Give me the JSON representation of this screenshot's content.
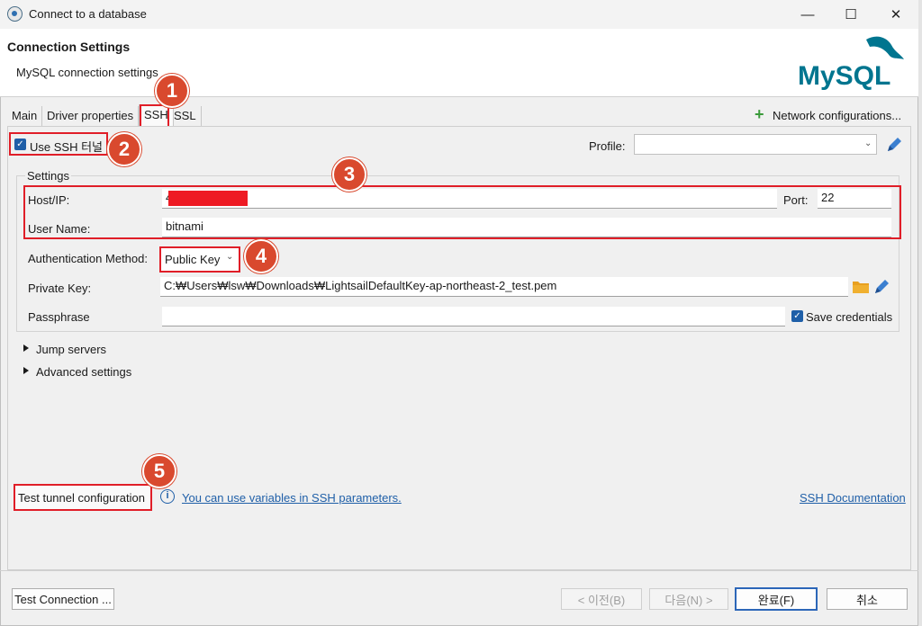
{
  "window": {
    "title": "Connect to a database",
    "minimize": "—",
    "maximize": "☐",
    "close": "✕"
  },
  "header": {
    "title": "Connection Settings",
    "subtitle": "MySQL connection settings",
    "logo_text": "MySQL"
  },
  "tabs": [
    {
      "label": "Main"
    },
    {
      "label": "Driver properties"
    },
    {
      "label": "SSH"
    },
    {
      "label": "SSL"
    }
  ],
  "network_config": "Network configurations...",
  "ssh": {
    "use_tunnel_label": "Use SSH 터널",
    "use_tunnel_checked": true,
    "profile_label": "Profile:",
    "profile_value": "",
    "settings_group": "Settings",
    "host_label": "Host/IP:",
    "host_value": "4",
    "port_label": "Port:",
    "port_value": "22",
    "username_label": "User Name:",
    "username_value": "bitnami",
    "auth_label": "Authentication Method:",
    "auth_value": "Public Key",
    "private_key_label": "Private Key:",
    "private_key_value": "C:₩Users₩lsw₩Downloads₩LightsailDefaultKey-ap-northeast-2_test.pem",
    "passphrase_label": "Passphrase",
    "passphrase_value": "",
    "save_credentials_label": "Save credentials",
    "save_credentials_checked": true,
    "jump_servers": "Jump servers",
    "advanced_settings": "Advanced settings",
    "test_tunnel": "Test tunnel configuration",
    "variables_hint": "You can use variables in SSH parameters.",
    "ssh_docs": "SSH Documentation"
  },
  "annotations": [
    "1",
    "2",
    "3",
    "4",
    "5"
  ],
  "footer": {
    "test_connection": "Test Connection ...",
    "back": "< 이전(B)",
    "next": "다음(N) >",
    "finish": "완료(F)",
    "cancel": "취소"
  },
  "colors": {
    "annotation_red": "#e01e28",
    "badge": "#d9492e",
    "link": "#1f5fa8",
    "accent": "#2c66b8",
    "mysql_blue": "#00758f",
    "mysql_orange": "#f29111"
  }
}
